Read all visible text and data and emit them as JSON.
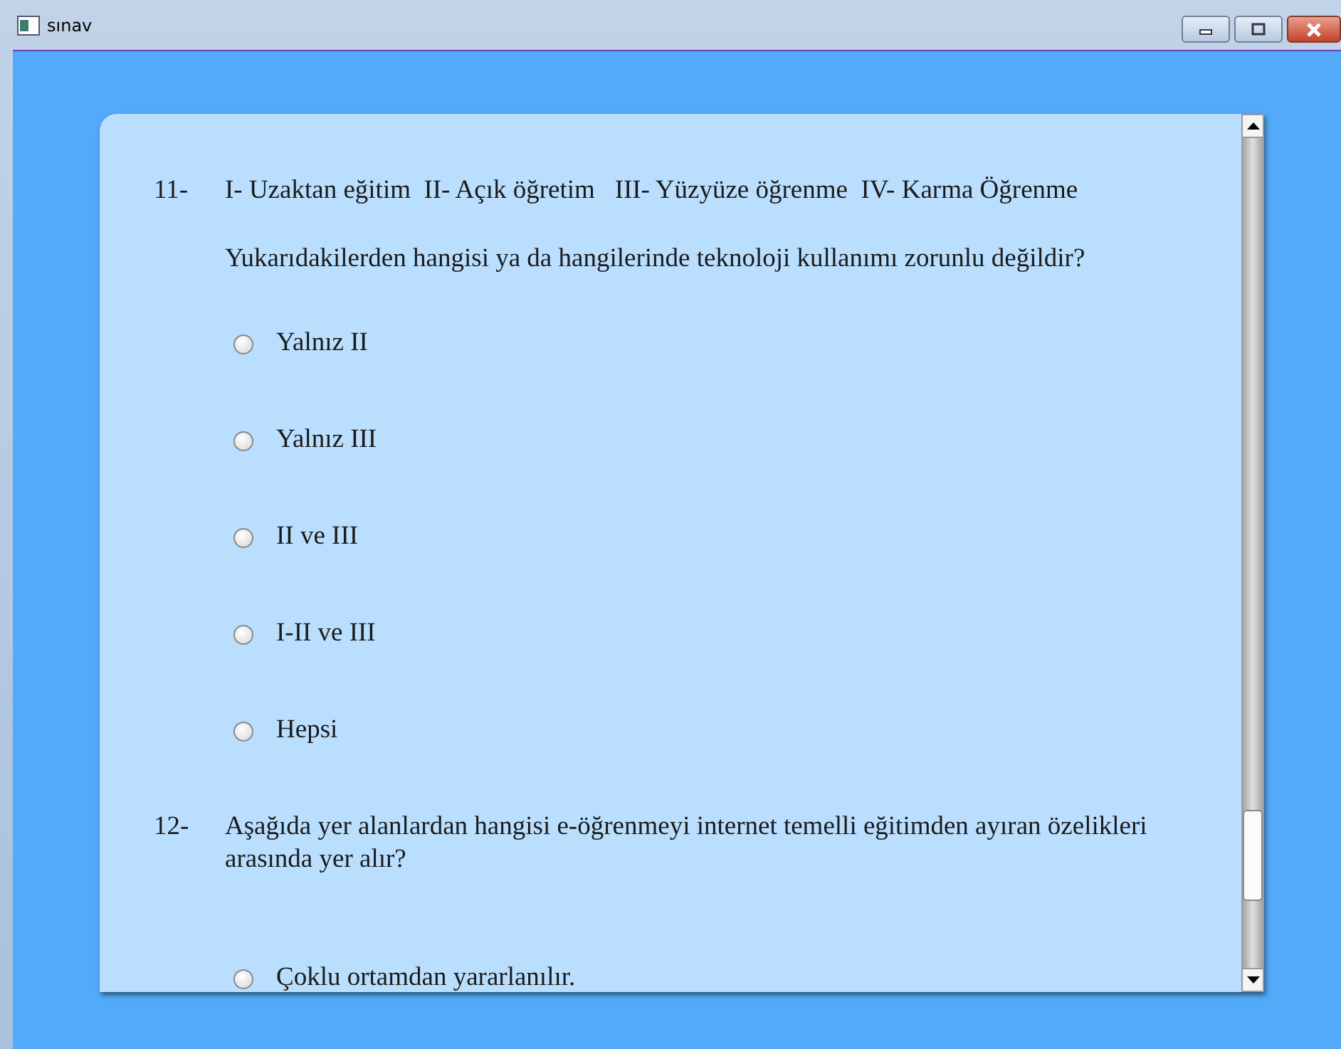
{
  "window": {
    "title": "sınav"
  },
  "questions": [
    {
      "number": "11-",
      "text": "I- Uzaktan eğitim  II- Açık öğretim   III- Yüzyüze öğrenme  IV- Karma Öğrenme",
      "prompt": "Yukarıdakilerden hangisi ya da hangilerinde teknoloji kullanımı zorunlu değildir?",
      "options": [
        {
          "label": "Yalnız II",
          "selected": false
        },
        {
          "label": "Yalnız III",
          "selected": false
        },
        {
          "label": "II ve III",
          "selected": false
        },
        {
          "label": "I-II ve III",
          "selected": false
        },
        {
          "label": "Hepsi",
          "selected": false
        }
      ]
    },
    {
      "number": "12-",
      "text": "Aşağıda yer alanlardan hangisi e-öğrenmeyi internet temelli eğitimden ayıran özelikleri arasında yer alır?",
      "options": [
        {
          "label": "Çoklu ortamdan yararlanılır.",
          "selected": false
        }
      ]
    }
  ]
}
